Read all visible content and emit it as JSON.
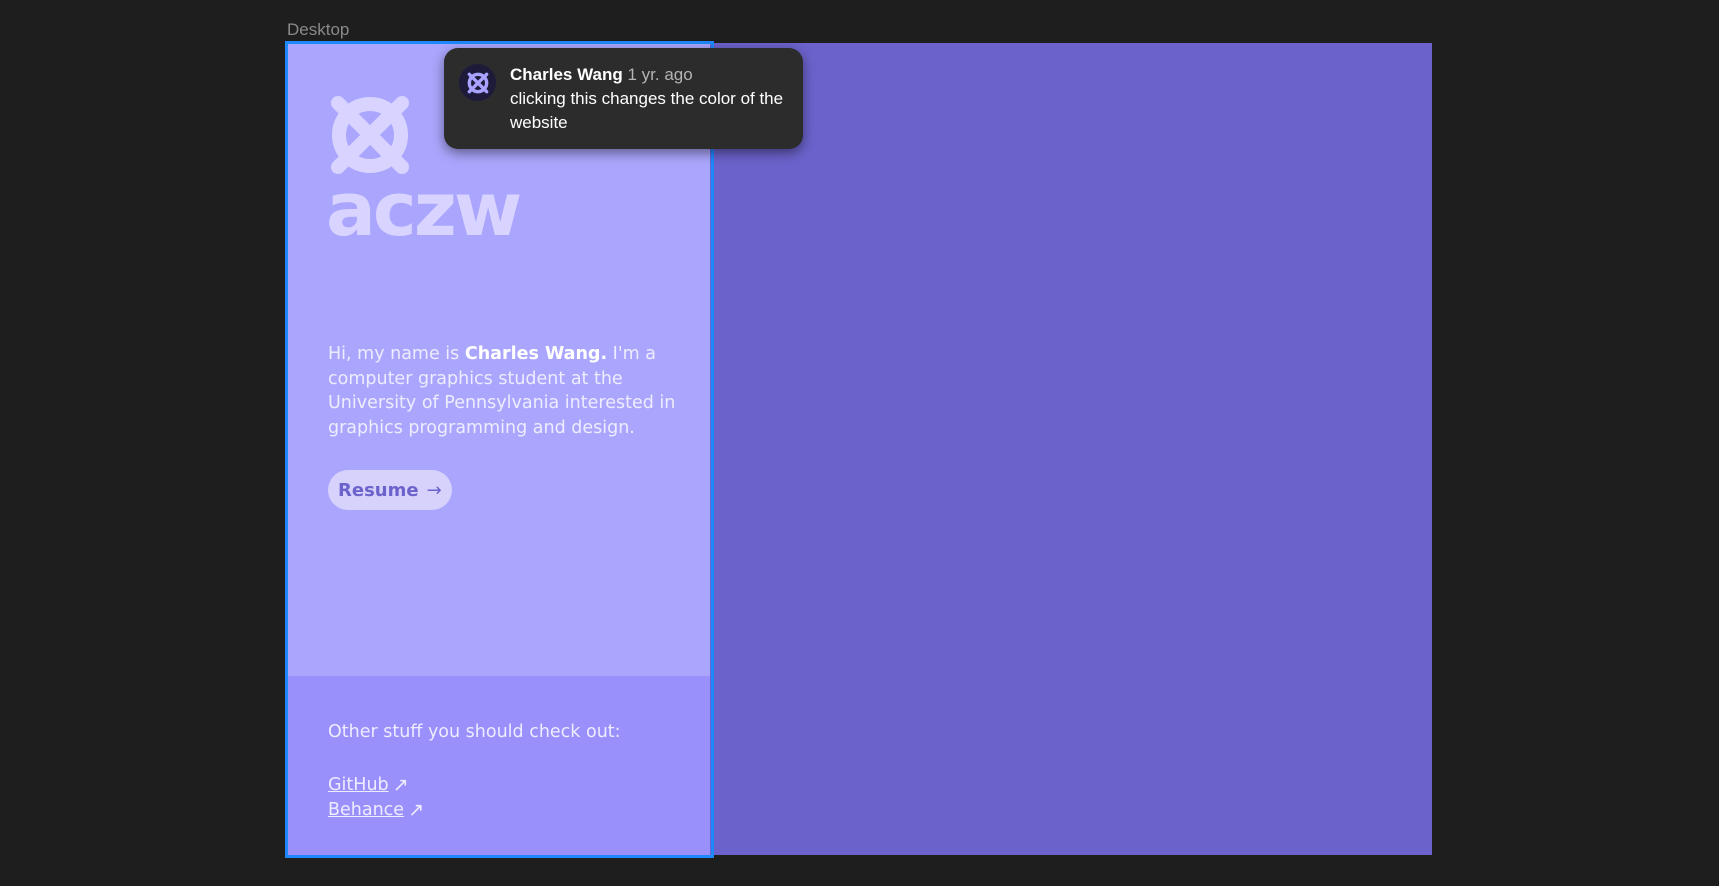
{
  "frame": {
    "label": "Desktop"
  },
  "site": {
    "logo_text": "aczw",
    "bio": {
      "prefix": "Hi, my name is ",
      "name": "Charles Wang.",
      "suffix": " I'm a computer graphics student at the University of Pennsylvania interested in graphics programming and design."
    },
    "resume": {
      "label": "Resume",
      "arrow": "→"
    },
    "other": {
      "title": "Other stuff you should check out:",
      "links": [
        {
          "label": "GitHub",
          "arrow": "↗"
        },
        {
          "label": "Behance",
          "arrow": "↗"
        }
      ]
    }
  },
  "comment": {
    "author": "Charles Wang",
    "time": "1 yr. ago",
    "text": "clicking this changes the color of the website"
  },
  "colors": {
    "canvas_bg": "#1e1e1e",
    "frame_bg": "#6b63cb",
    "panel_top": "#aaa6fd",
    "panel_bottom": "#9a90fc",
    "selection": "#1e88ff",
    "comment_bg": "#2c2c2c"
  },
  "icons": {
    "logo": "x-circle-icon",
    "resume_arrow": "arrow-right-icon",
    "external_link": "arrow-up-right-icon"
  }
}
